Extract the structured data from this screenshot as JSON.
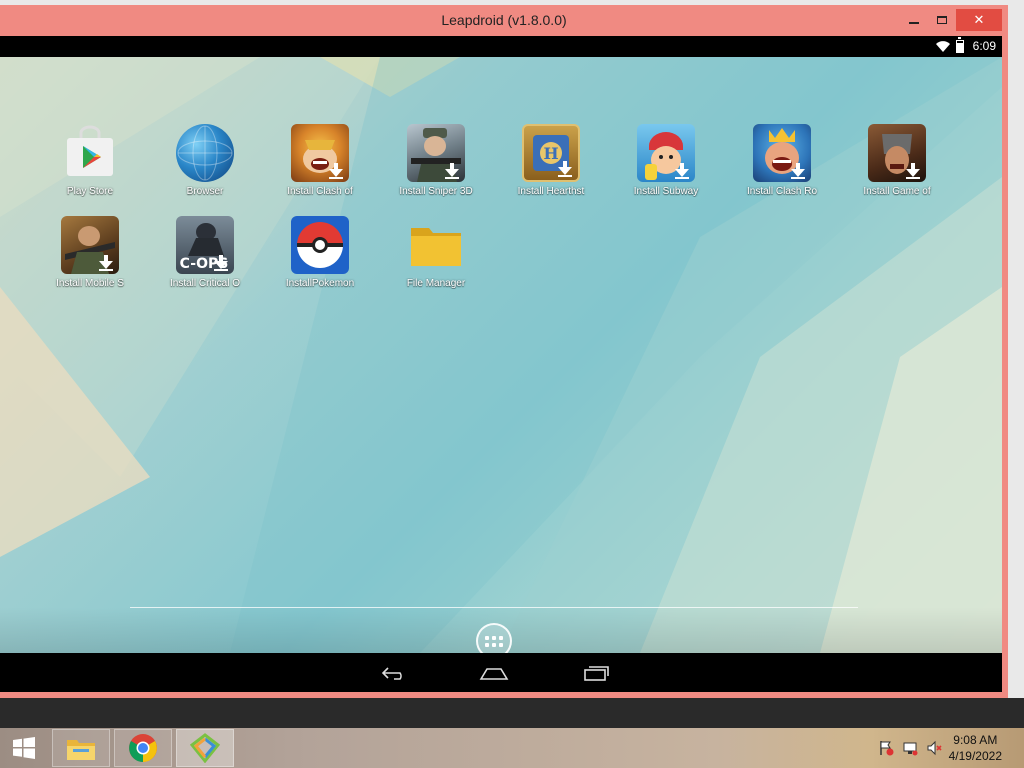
{
  "window": {
    "title": "Leapdroid (v1.8.0.0)"
  },
  "android": {
    "status_time": "6:09",
    "apps": [
      {
        "label": "Play Store",
        "icon": "play-store-icon",
        "download": false
      },
      {
        "label": "Browser",
        "icon": "browser-globe-icon",
        "download": false
      },
      {
        "label": "Install Clash of",
        "icon": "clash-of-clans-icon",
        "download": true
      },
      {
        "label": "Install Sniper 3D",
        "icon": "sniper-3d-icon",
        "download": true
      },
      {
        "label": "Install Hearthst",
        "icon": "hearthstone-icon",
        "download": true
      },
      {
        "label": "Install Subway",
        "icon": "subway-surfers-icon",
        "download": true
      },
      {
        "label": "Install Clash Ro",
        "icon": "clash-royale-icon",
        "download": true
      },
      {
        "label": "Install Game of",
        "icon": "game-of-war-icon",
        "download": true
      },
      {
        "label": "Install Mobile S",
        "icon": "mobile-strike-icon",
        "download": true
      },
      {
        "label": "Install Critical O",
        "icon": "critical-ops-icon",
        "download": true
      },
      {
        "label": "InstallPokemon",
        "icon": "pokeball-icon",
        "download": false
      },
      {
        "label": "File Manager",
        "icon": "folder-icon",
        "download": false
      }
    ],
    "cops_logo_text": "C-OPS"
  },
  "taskbar": {
    "items": [
      "start-icon",
      "file-explorer-icon",
      "chrome-icon",
      "leapdroid-icon"
    ],
    "clock_time": "9:08 AM",
    "clock_date": "4/19/2022"
  }
}
